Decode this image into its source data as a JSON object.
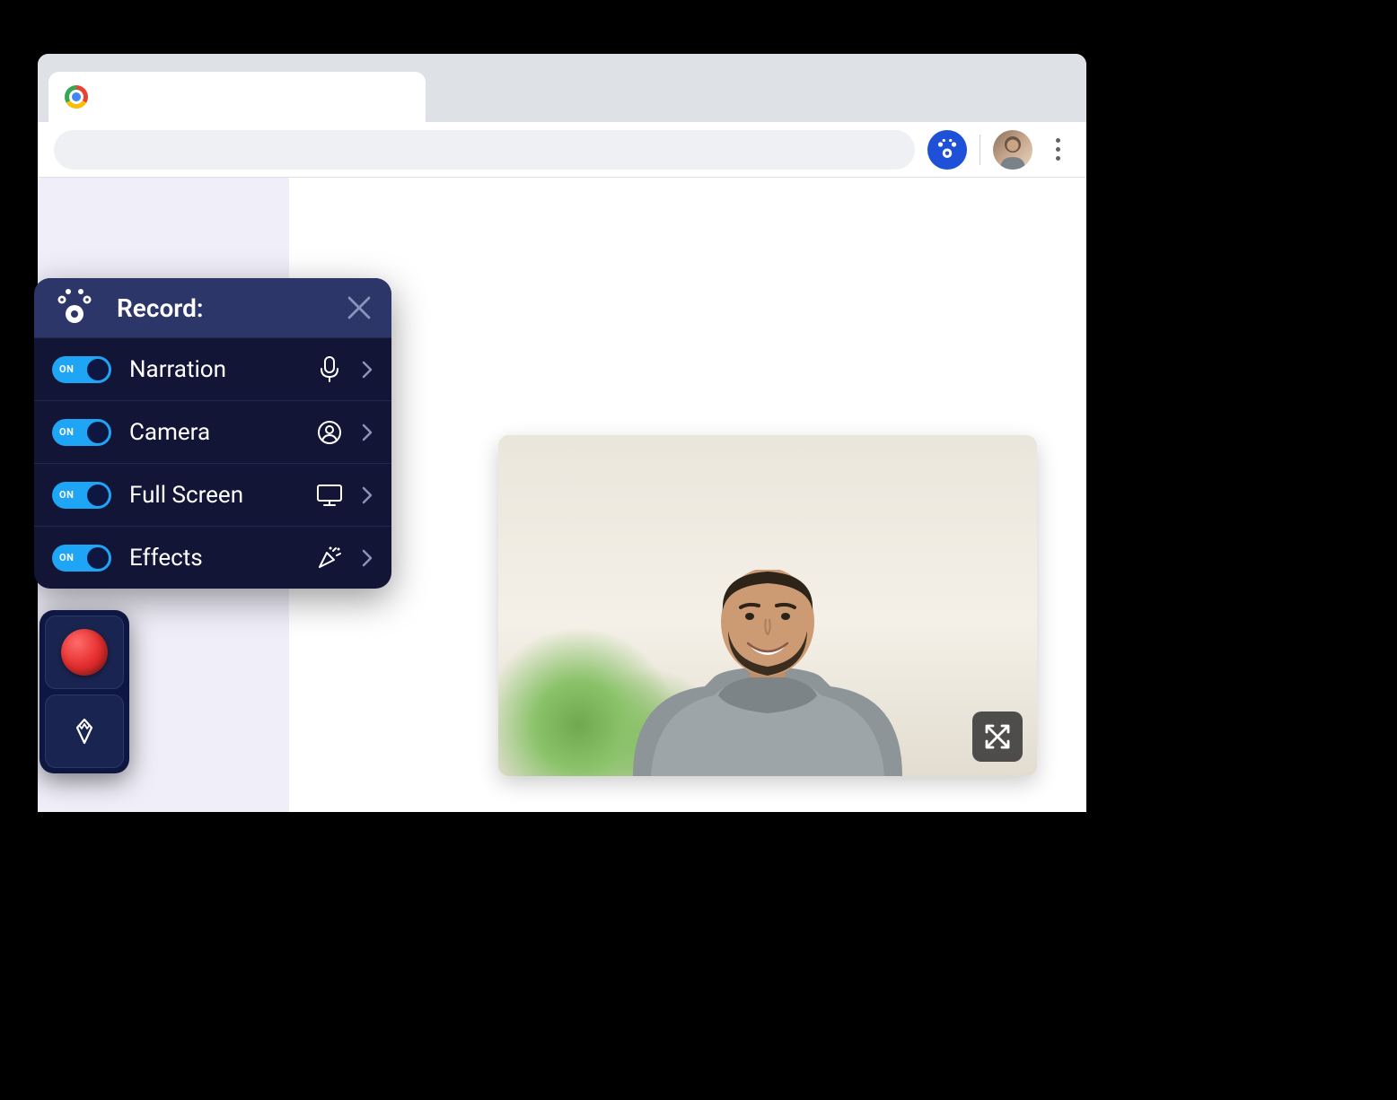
{
  "panel": {
    "title": "Record:",
    "rows": [
      {
        "label": "Narration",
        "state": "ON",
        "icon": "microphone-icon"
      },
      {
        "label": "Camera",
        "state": "ON",
        "icon": "person-circle-icon"
      },
      {
        "label": "Full Screen",
        "state": "ON",
        "icon": "monitor-icon"
      },
      {
        "label": "Effects",
        "state": "ON",
        "icon": "confetti-icon"
      }
    ]
  },
  "toggle_on_label": "ON",
  "colors": {
    "panel_bg": "#121536",
    "panel_header": "#2d3668",
    "toggle_on": "#1ea5f5",
    "knob": "#0d1742"
  }
}
